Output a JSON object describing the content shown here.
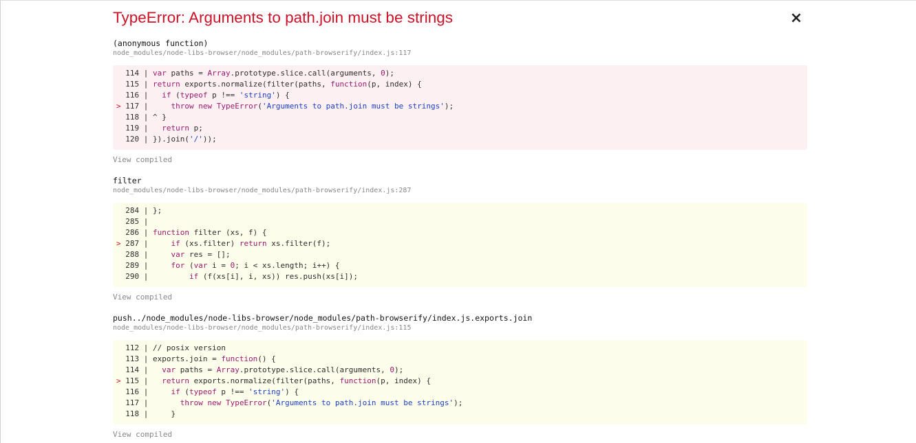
{
  "error": {
    "title": "TypeError: Arguments to path.join must be strings",
    "close_glyph": "×"
  },
  "frames": [
    {
      "function": "(anonymous function)",
      "path": "node_modules/node-libs-browser/node_modules/path-browserify/index.js:117",
      "style": "error",
      "lines": [
        "  114 | var paths = Array.prototype.slice.call(arguments, 0);",
        "  115 | return exports.normalize(filter(paths, function(p, index) {",
        "  116 |   if (typeof p !== 'string') {",
        "> 117 |     throw new TypeError('Arguments to path.join must be strings');",
        "  118 | ^ }",
        "  119 |   return p;",
        "  120 | }).join('/'));"
      ],
      "view_compiled": "View compiled"
    },
    {
      "function": "filter",
      "path": "node_modules/node-libs-browser/node_modules/path-browserify/index.js:287",
      "style": "warn",
      "lines": [
        "  284 | };",
        "  285 |",
        "  286 | function filter (xs, f) {",
        "> 287 |     if (xs.filter) return xs.filter(f);",
        "  288 |     var res = [];",
        "  289 |     for (var i = 0; i < xs.length; i++) {",
        "  290 |         if (f(xs[i], i, xs)) res.push(xs[i]);"
      ],
      "view_compiled": "View compiled"
    },
    {
      "function": "push../node_modules/node-libs-browser/node_modules/path-browserify/index.js.exports.join",
      "path": "node_modules/node-libs-browser/node_modules/path-browserify/index.js:115",
      "style": "warn",
      "lines": [
        "  112 | // posix version",
        "  113 | exports.join = function() {",
        "  114 |   var paths = Array.prototype.slice.call(arguments, 0);",
        "> 115 |   return exports.normalize(filter(paths, function(p, index) {",
        "  116 |     if (typeof p !== 'string') {",
        "  117 |       throw new TypeError('Arguments to path.join must be strings');",
        "  118 |     }"
      ],
      "view_compiled": "View compiled"
    }
  ],
  "colors": {
    "error_title": "#ce1126",
    "error_block_bg": "#fcf0f2",
    "warn_block_bg": "#fdfdeb",
    "muted_text": "#878787",
    "keyword": "#9b1b6d",
    "string": "#1e40c0"
  }
}
